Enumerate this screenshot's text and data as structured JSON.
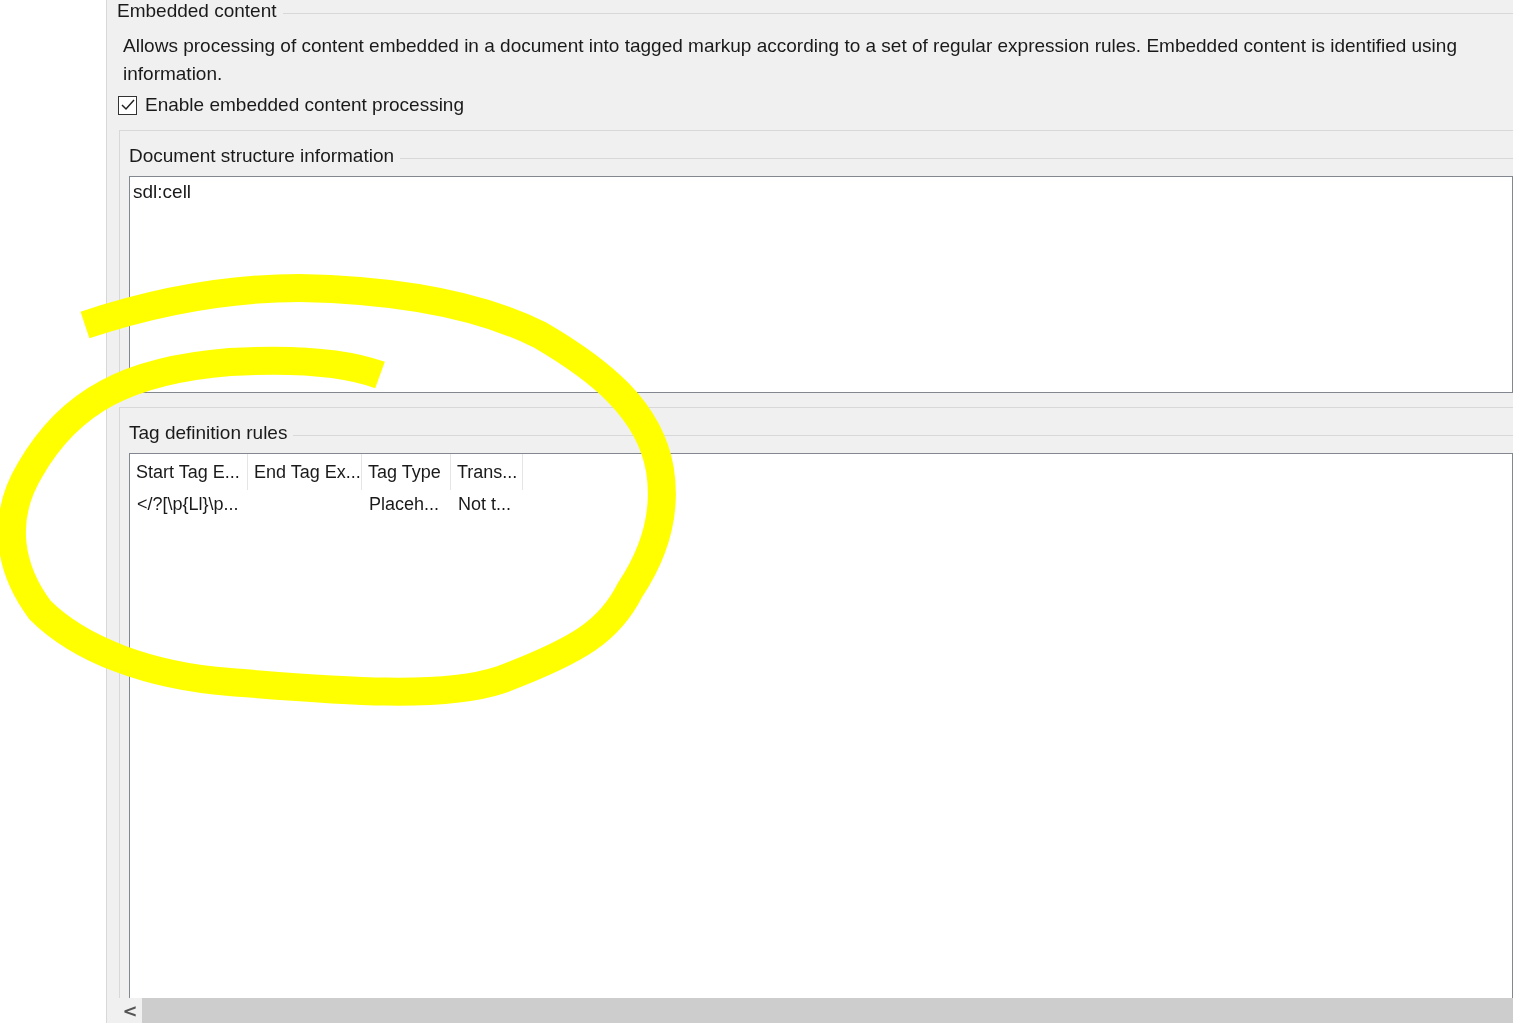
{
  "embedded_content": {
    "title": "Embedded content",
    "description_lines": [
      "Allows processing of content embedded in a document into tagged markup according to a set of regular expression rules. Embedded content is identified using",
      "information."
    ],
    "enable_checkbox": {
      "label": "Enable embedded content processing",
      "checked": true
    }
  },
  "document_structure": {
    "title": "Document structure information",
    "items": [
      "sdl:cell"
    ]
  },
  "tag_definition_rules": {
    "title": "Tag definition rules",
    "columns": [
      "Start Tag E...",
      "End Tag Ex...",
      "Tag Type",
      "Trans..."
    ],
    "rows": [
      [
        "</?[\\p{Ll}\\p...",
        "",
        "Placeh...",
        "Not t..."
      ]
    ]
  },
  "scrollbar": {
    "left_arrow": "<"
  }
}
